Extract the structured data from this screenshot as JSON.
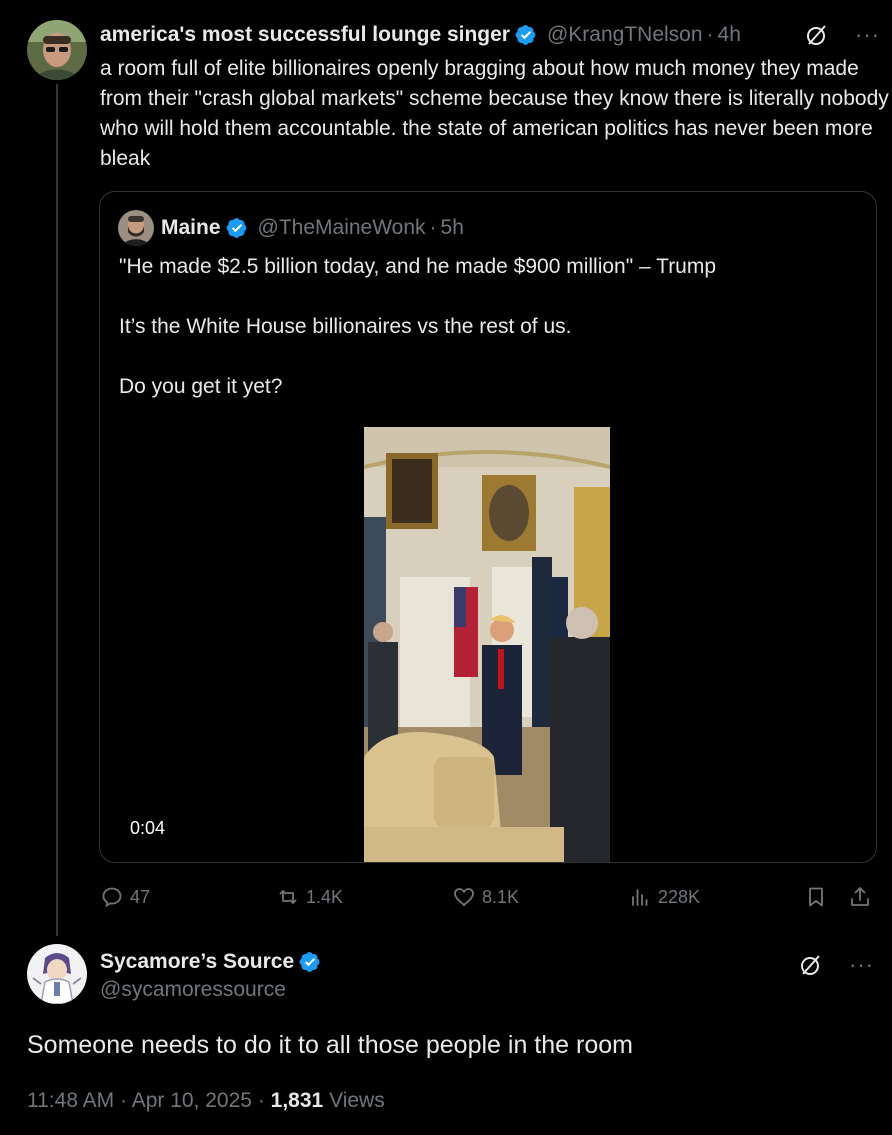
{
  "post1": {
    "author": {
      "display_name": "america's most successful lounge singer",
      "handle": "@KrangTNelson",
      "time": "4h",
      "verified": true
    },
    "text": "a room full of elite billionaires openly bragging about how much money they made from their \"crash global markets\"  scheme because they know there is literally nobody who will hold them accountable. the state of american politics has never been more bleak",
    "quoted": {
      "author": {
        "display_name": "Maine",
        "handle": "@TheMaineWonk",
        "time": "5h",
        "verified": true
      },
      "text": "\"He made $2.5 billion today, and he made $900 million\" – Trump\n\nIt’s the White House billionaires vs the rest of us.\n\nDo you get it yet?",
      "video_duration": "0:04"
    },
    "actions": {
      "replies": "47",
      "reposts": "1.4K",
      "likes": "8.1K",
      "views": "228K"
    }
  },
  "post2": {
    "author": {
      "display_name": "Sycamore’s Source",
      "handle": "@sycamoressource",
      "verified": true
    },
    "text": "Someone needs to do it to all those people in the room",
    "time": "11:48 AM",
    "date": "Apr 10, 2025",
    "views_count": "1,831",
    "views_label": "Views"
  },
  "separator": "·",
  "colors": {
    "background": "#000000",
    "text_primary": "#e7e9ea",
    "text_secondary": "#71767b",
    "verified_blue": "#1d9bf0",
    "border": "#2f3336"
  }
}
